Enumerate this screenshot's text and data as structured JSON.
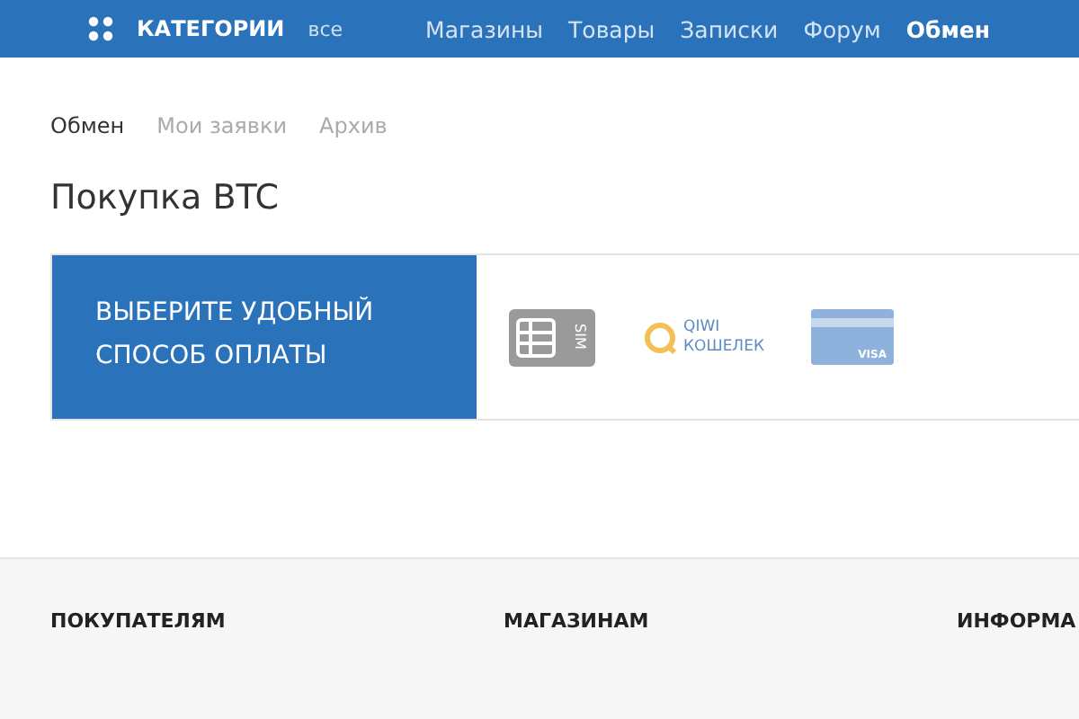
{
  "header": {
    "categories": "КАТЕГОРИИ",
    "all": "все",
    "menu": [
      {
        "label": "Магазины",
        "selected": false
      },
      {
        "label": "Товары",
        "selected": false
      },
      {
        "label": "Записки",
        "selected": false
      },
      {
        "label": "Форум",
        "selected": false
      },
      {
        "label": "Обмен",
        "selected": true
      }
    ]
  },
  "tabs": [
    {
      "label": "Обмен",
      "selected": true
    },
    {
      "label": "Мои заявки",
      "selected": false
    },
    {
      "label": "Архив",
      "selected": false
    }
  ],
  "title": "Покупка BTC",
  "payment": {
    "prompt": "ВЫБЕРИТЕ УДОБНЫЙ СПОСОБ ОПЛАТЫ",
    "methods": [
      {
        "kind": "sim",
        "label": "SIM"
      },
      {
        "kind": "qiwi",
        "label": "QIWI",
        "sublabel": "КОШЕЛЕК"
      },
      {
        "kind": "card",
        "label": "VISA"
      }
    ]
  },
  "footer": {
    "columns": [
      {
        "heading": "ПОКУПАТЕЛЯМ"
      },
      {
        "heading": "МАГАЗИНАМ"
      },
      {
        "heading": "ИНФОРМА"
      }
    ]
  }
}
